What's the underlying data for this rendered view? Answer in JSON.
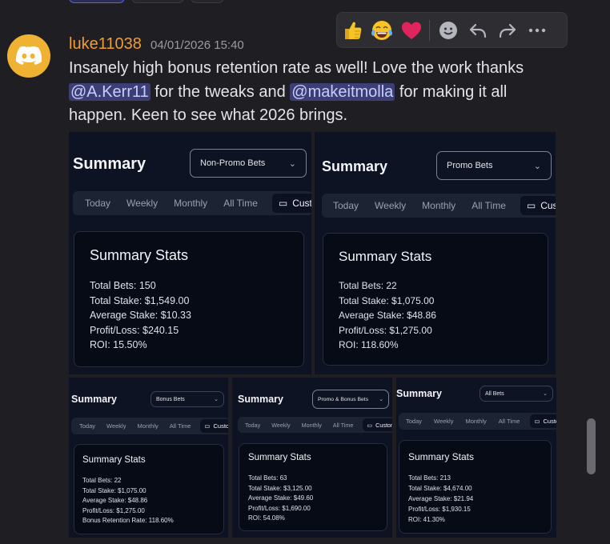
{
  "message": {
    "username": "luke11038",
    "timestamp": "04/01/2026 15:40",
    "text_parts": [
      "Insanely high bonus retention rate as well! Love the work thanks ",
      " for the tweaks and ",
      " for making it all happen. Keen to see what 2026 brings."
    ],
    "mentions": [
      "@A.Kerr11",
      "@makeitmolla"
    ]
  },
  "reactions": {
    "icons": [
      "thumbs-up-emoji",
      "tears-of-joy-emoji",
      "red-heart-emoji",
      "add-reaction-icon",
      "reply-icon",
      "forward-icon",
      "more-options-icon"
    ],
    "colors": {
      "heart": "#e0245e",
      "emoji_face": "#f7c325",
      "accent_orange": "#ef9b36",
      "mention_bg": "#3b3f76",
      "avatar": "#f0b232"
    }
  },
  "screenshots": [
    {
      "title": "Summary",
      "dropdown": "Non-Promo Bets",
      "tabs": [
        "Today",
        "Weekly",
        "Monthly",
        "All Time",
        "Custom"
      ],
      "card_title": "Summary Stats",
      "stats": [
        "Total Bets: 150",
        "Total Stake: $1,549.00",
        "Average Stake: $10.33",
        "Profit/Loss: $240.15",
        "ROI: 15.50%"
      ]
    },
    {
      "title": "Summary",
      "dropdown": "Promo Bets",
      "tabs": [
        "Today",
        "Weekly",
        "Monthly",
        "All Time",
        "Custom"
      ],
      "card_title": "Summary Stats",
      "stats": [
        "Total Bets: 22",
        "Total Stake: $1,075.00",
        "Average Stake: $48.86",
        "Profit/Loss: $1,275.00",
        "ROI: 118.60%"
      ]
    },
    {
      "title": "Summary",
      "dropdown": "Bonus Bets",
      "tabs": [
        "Today",
        "Weekly",
        "Monthly",
        "All Time",
        "Custom"
      ],
      "card_title": "Summary Stats",
      "stats": [
        "Total Bets: 22",
        "Total Stake: $1,075.00",
        "Average Stake: $48.86",
        "Profit/Loss: $1,275.00",
        "Bonus Retention Rate: 118.60%"
      ]
    },
    {
      "title": "Summary",
      "dropdown": "Promo & Bonus Bets",
      "tabs": [
        "Today",
        "Weekly",
        "Monthly",
        "All Time",
        "Custom"
      ],
      "card_title": "Summary Stats",
      "stats": [
        "Total Bets: 63",
        "Total Stake: $3,125.00",
        "Average Stake: $49.60",
        "Profit/Loss: $1,690.00",
        "ROI: 54.08%"
      ]
    },
    {
      "title": "Summary",
      "dropdown": "All Bets",
      "tabs": [
        "Today",
        "Weekly",
        "Monthly",
        "All Time",
        "Custom"
      ],
      "card_title": "Summary Stats",
      "stats": [
        "Total Bets: 213",
        "Total Stake: $4,674.00",
        "Average Stake: $21.94",
        "Profit/Loss: $1,930.15",
        "ROI: 41.30%"
      ]
    }
  ]
}
